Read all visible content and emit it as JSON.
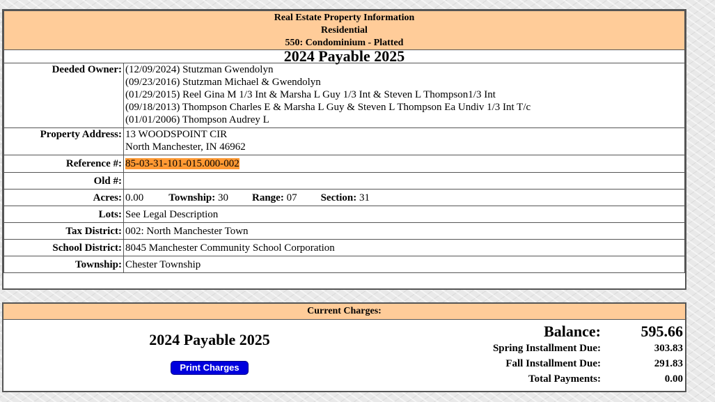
{
  "header": {
    "title": "Real Estate Property Information",
    "class": "Residential",
    "subclass": "550: Condominium - Platted",
    "year": "2024 Payable 2025"
  },
  "fields": {
    "deeded_owner_label": "Deeded Owner:",
    "deeded_owner_lines": [
      "(12/09/2024) Stutzman Gwendolyn",
      "(09/23/2016) Stutzman Michael & Gwendolyn",
      "(01/29/2015) Reel Gina M 1/3 Int & Marsha L Guy 1/3 Int & Steven L Thompson1/3 Int",
      "(09/18/2013) Thompson Charles E & Marsha L Guy & Steven L Thompson Ea Undiv 1/3 Int T/c",
      "(01/01/2006) Thompson Audrey L"
    ],
    "property_address_label": "Property Address:",
    "property_address_lines": [
      "13 WOODSPOINT CIR",
      "North Manchester, IN 46962"
    ],
    "reference_label": "Reference #:",
    "reference": "85-03-31-101-015.000-002",
    "old_label": "Old #:",
    "old": "",
    "acres_label": "Acres:",
    "acres": "0.00",
    "township_inline_label": "Township:",
    "township_inline": "30",
    "range_label": "Range:",
    "range": "07",
    "section_label": "Section:",
    "section": "31",
    "lots_label": "Lots:",
    "lots": "See Legal Description",
    "tax_district_label": "Tax District:",
    "tax_district": "002: North Manchester Town",
    "school_district_label": "School District:",
    "school_district": "8045 Manchester Community School Corporation",
    "township_label": "Township:",
    "township": "Chester Township"
  },
  "charges": {
    "header": "Current Charges:",
    "year": "2024 Payable 2025",
    "print_label": "Print Charges",
    "balance_label": "Balance:",
    "balance": "595.66",
    "spring_label": "Spring Installment Due:",
    "spring": "303.83",
    "fall_label": "Fall Installment Due:",
    "fall": "291.83",
    "total_label": "Total Payments:",
    "total": "0.00"
  },
  "colors": {
    "header_bg": "#ffcc99",
    "highlight": "#ff9933",
    "button_bg": "#0000dd"
  }
}
